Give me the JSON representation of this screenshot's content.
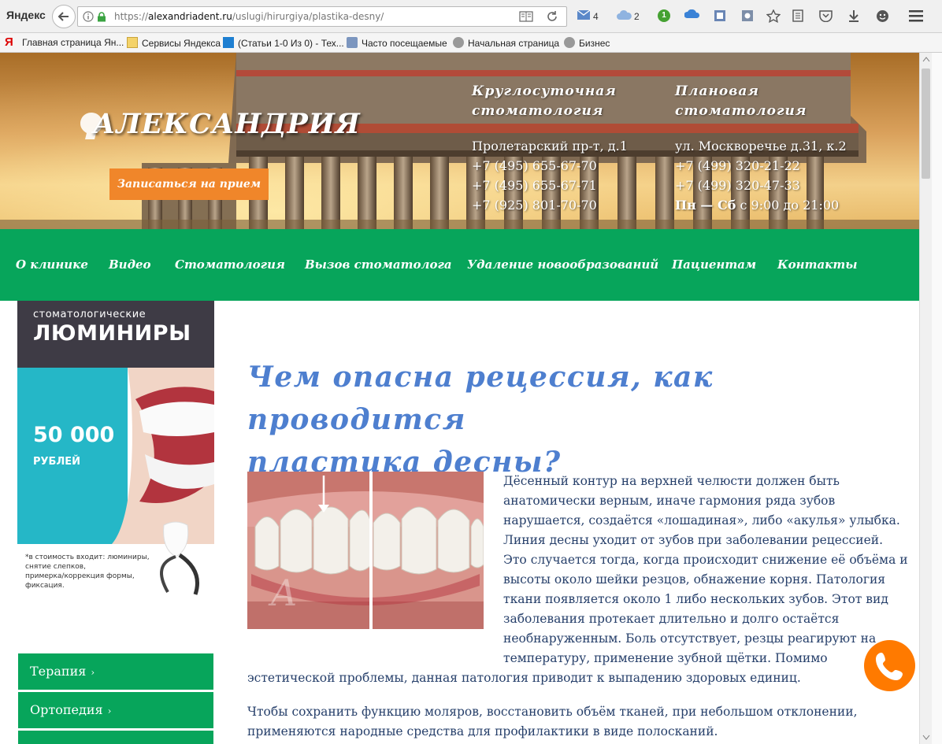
{
  "browser": {
    "brand": "Яндекс",
    "url_prefix": "https://",
    "url_host": "alexandriadent.ru",
    "url_path": "/uslugi/hirurgiya/plastika-desny/",
    "mail_count": "4",
    "cloud_count": "2",
    "badge_count": "1"
  },
  "bookmarks": [
    {
      "label": "Главная страница Ян..."
    },
    {
      "label": "Сервисы Яндекса"
    },
    {
      "label": "(Статьи 1-0 Из 0) - Тех..."
    },
    {
      "label": "Часто посещаемые"
    },
    {
      "label": "Начальная страница"
    },
    {
      "label": "Бизнес"
    }
  ],
  "header": {
    "logo": "АЛЕКСАНДРИЯ",
    "cta": "Записаться на прием",
    "col1": {
      "title1": "Круглосуточная",
      "title2": "стоматология",
      "lines": [
        "Пролетарский пр-т, д.1",
        "+7 (495) 655-67-70",
        "+7 (495) 655-67-71",
        "+7 (925) 801-70-70"
      ]
    },
    "col2": {
      "title1": "Плановая",
      "title2": "стоматология",
      "lines": [
        "ул. Москворечье д.31, к.2",
        "+7 (499) 320-21-22",
        "+7 (499) 320-47-33"
      ],
      "hours_bold": "Пн — Сб",
      "hours_rest": " с 9:00 до 21:00"
    }
  },
  "nav": [
    "О клинике",
    "Видео",
    "Стоматология",
    "Вызов стоматолога",
    "Удаление новообразований",
    "Пациентам",
    "Контакты"
  ],
  "banner": {
    "subtitle": "стоматологические",
    "title": "ЛЮМИНИРЫ",
    "price": "50 000",
    "currency": "РУБЛЕЙ",
    "note": [
      "*в стоимость входит: люминиры,",
      "снятие слепков,",
      "примерка/коррекция формы,",
      "фиксация."
    ]
  },
  "side_menu": [
    "Терапия",
    "Ортопедия"
  ],
  "side_menu_chevron": "›",
  "article": {
    "title1": "Чем опасна рецессия, как проводится",
    "title2": "пластика десны?",
    "para1": [
      "Дёсенный контур на верхней челюсти должен быть",
      "анатомически верным, иначе гармония ряда зубов",
      "нарушается, создаётся «лошадиная», либо «акулья» улыбка.",
      "Линия десны уходит от зубов при заболевании рецессией.",
      "Это случается тогда, когда происходит снижение её объёма и",
      "высоты около шейки резцов, обнажение корня. Патология",
      "ткани появляется около 1 либо нескольких зубов. Этот вид",
      "заболевания протекает длительно и долго остаётся",
      "необнаруженным. Боль отсутствует, резцы реагируют на",
      "температуру, применение зубной щётки. Помимо",
      "эстетической проблемы, данная патология приводит к выпадению здоровых единиц."
    ],
    "para2": [
      "Чтобы сохранить функцию моляров, восстановить объём тканей, при небольшом отклонении,",
      "применяются народные средства для профилактики в виде полосканий."
    ]
  },
  "colors": {
    "green": "#07a55b",
    "orange": "#f0862a",
    "title_blue": "#4e7fcf",
    "text_navy": "#27406b"
  },
  "icons": [
    "back-arrow-icon",
    "info-icon",
    "lock-icon",
    "reader-icon",
    "reload-icon",
    "mail-icon",
    "cloud-icon",
    "star-icon",
    "menu-icon",
    "phone-icon"
  ]
}
